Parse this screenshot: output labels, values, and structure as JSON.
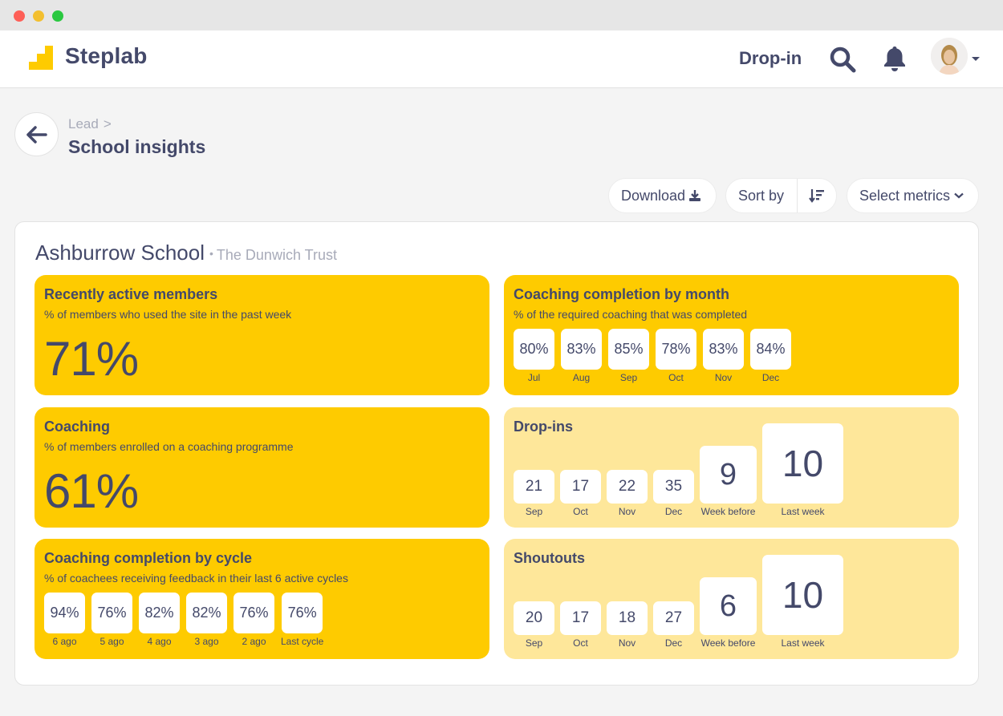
{
  "window": {
    "controls": [
      "close",
      "minimize",
      "maximize"
    ]
  },
  "navbar": {
    "brand": "Steplab",
    "brand_color": "#fecb00",
    "dropin_label": "Drop-in",
    "icons": [
      "search-icon",
      "bell-icon",
      "avatar",
      "caret-down-icon"
    ]
  },
  "header": {
    "breadcrumb": "Lead",
    "breadcrumb_separator": ">",
    "title": "School insights"
  },
  "toolbar": {
    "download_label": "Download",
    "sort_label": "Sort by",
    "metrics_label": "Select metrics"
  },
  "school": {
    "name": "Ashburrow School",
    "separator": "•",
    "trust": "The Dunwich Trust"
  },
  "cards": {
    "active": {
      "title": "Recently active members",
      "subtitle": "% of members who used the site in the past week",
      "value": "71%"
    },
    "coaching": {
      "title": "Coaching",
      "subtitle": "% of members enrolled on a coaching programme",
      "value": "61%"
    },
    "by_cycle": {
      "title": "Coaching completion by cycle",
      "subtitle": "% of coachees receiving feedback in their last 6 active cycles",
      "items": [
        {
          "value": "94%",
          "label": "6 ago"
        },
        {
          "value": "76%",
          "label": "5 ago"
        },
        {
          "value": "82%",
          "label": "4 ago"
        },
        {
          "value": "82%",
          "label": "3 ago"
        },
        {
          "value": "76%",
          "label": "2 ago"
        },
        {
          "value": "76%",
          "label": "Last cycle"
        }
      ]
    },
    "by_month": {
      "title": "Coaching completion by month",
      "subtitle": "% of the required coaching that was completed",
      "items": [
        {
          "value": "80%",
          "label": "Jul"
        },
        {
          "value": "83%",
          "label": "Aug"
        },
        {
          "value": "85%",
          "label": "Sep"
        },
        {
          "value": "78%",
          "label": "Oct"
        },
        {
          "value": "83%",
          "label": "Nov"
        },
        {
          "value": "84%",
          "label": "Dec"
        }
      ]
    },
    "dropins": {
      "title": "Drop-ins",
      "items": [
        {
          "value": "21",
          "label": "Sep"
        },
        {
          "value": "17",
          "label": "Oct"
        },
        {
          "value": "22",
          "label": "Nov"
        },
        {
          "value": "35",
          "label": "Dec"
        },
        {
          "value": "9",
          "label": "Week before"
        },
        {
          "value": "10",
          "label": "Last week"
        }
      ]
    },
    "shoutouts": {
      "title": "Shoutouts",
      "items": [
        {
          "value": "20",
          "label": "Sep"
        },
        {
          "value": "17",
          "label": "Oct"
        },
        {
          "value": "18",
          "label": "Nov"
        },
        {
          "value": "27",
          "label": "Dec"
        },
        {
          "value": "6",
          "label": "Week before"
        },
        {
          "value": "10",
          "label": "Last week"
        }
      ]
    }
  },
  "colors": {
    "primary_yellow": "#fecb00",
    "light_yellow": "#fee79a",
    "text_navy": "#44496a",
    "muted_grey": "#a8abb9"
  }
}
